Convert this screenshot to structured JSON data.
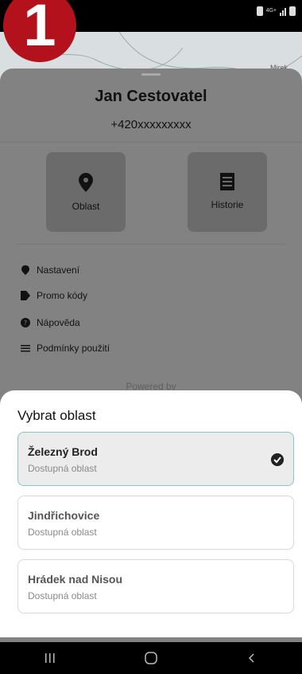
{
  "status_bar": {
    "network": "4G+",
    "signal_bars": 3
  },
  "map": {
    "badge": "1",
    "place_label": "Mirek"
  },
  "profile": {
    "name": "Jan Cestovatel",
    "phone": "+420xxxxxxxxx"
  },
  "tiles": [
    {
      "label": "Oblast",
      "icon": "location-pin-icon"
    },
    {
      "label": "Historie",
      "icon": "receipt-icon"
    }
  ],
  "menu": [
    {
      "label": "Nastavení",
      "icon": "location-pin-icon"
    },
    {
      "label": "Promo kódy",
      "icon": "tag-icon"
    },
    {
      "label": "Nápověda",
      "icon": "help-icon"
    },
    {
      "label": "Podmínky použití",
      "icon": "list-icon"
    }
  ],
  "footer": {
    "powered_by": "Powered by"
  },
  "area_sheet": {
    "title": "Vybrat oblast",
    "areas": [
      {
        "name": "Železný Brod",
        "status": "Dostupná oblast",
        "selected": true
      },
      {
        "name": "Jindřichovice",
        "status": "Dostupná oblast",
        "selected": false
      },
      {
        "name": "Hrádek nad Nisou",
        "status": "Dostupná oblast",
        "selected": false
      }
    ]
  },
  "colors": {
    "badge": "#b3111c",
    "selected_border": "#86c7c3",
    "dim_overlay": "#828282"
  }
}
